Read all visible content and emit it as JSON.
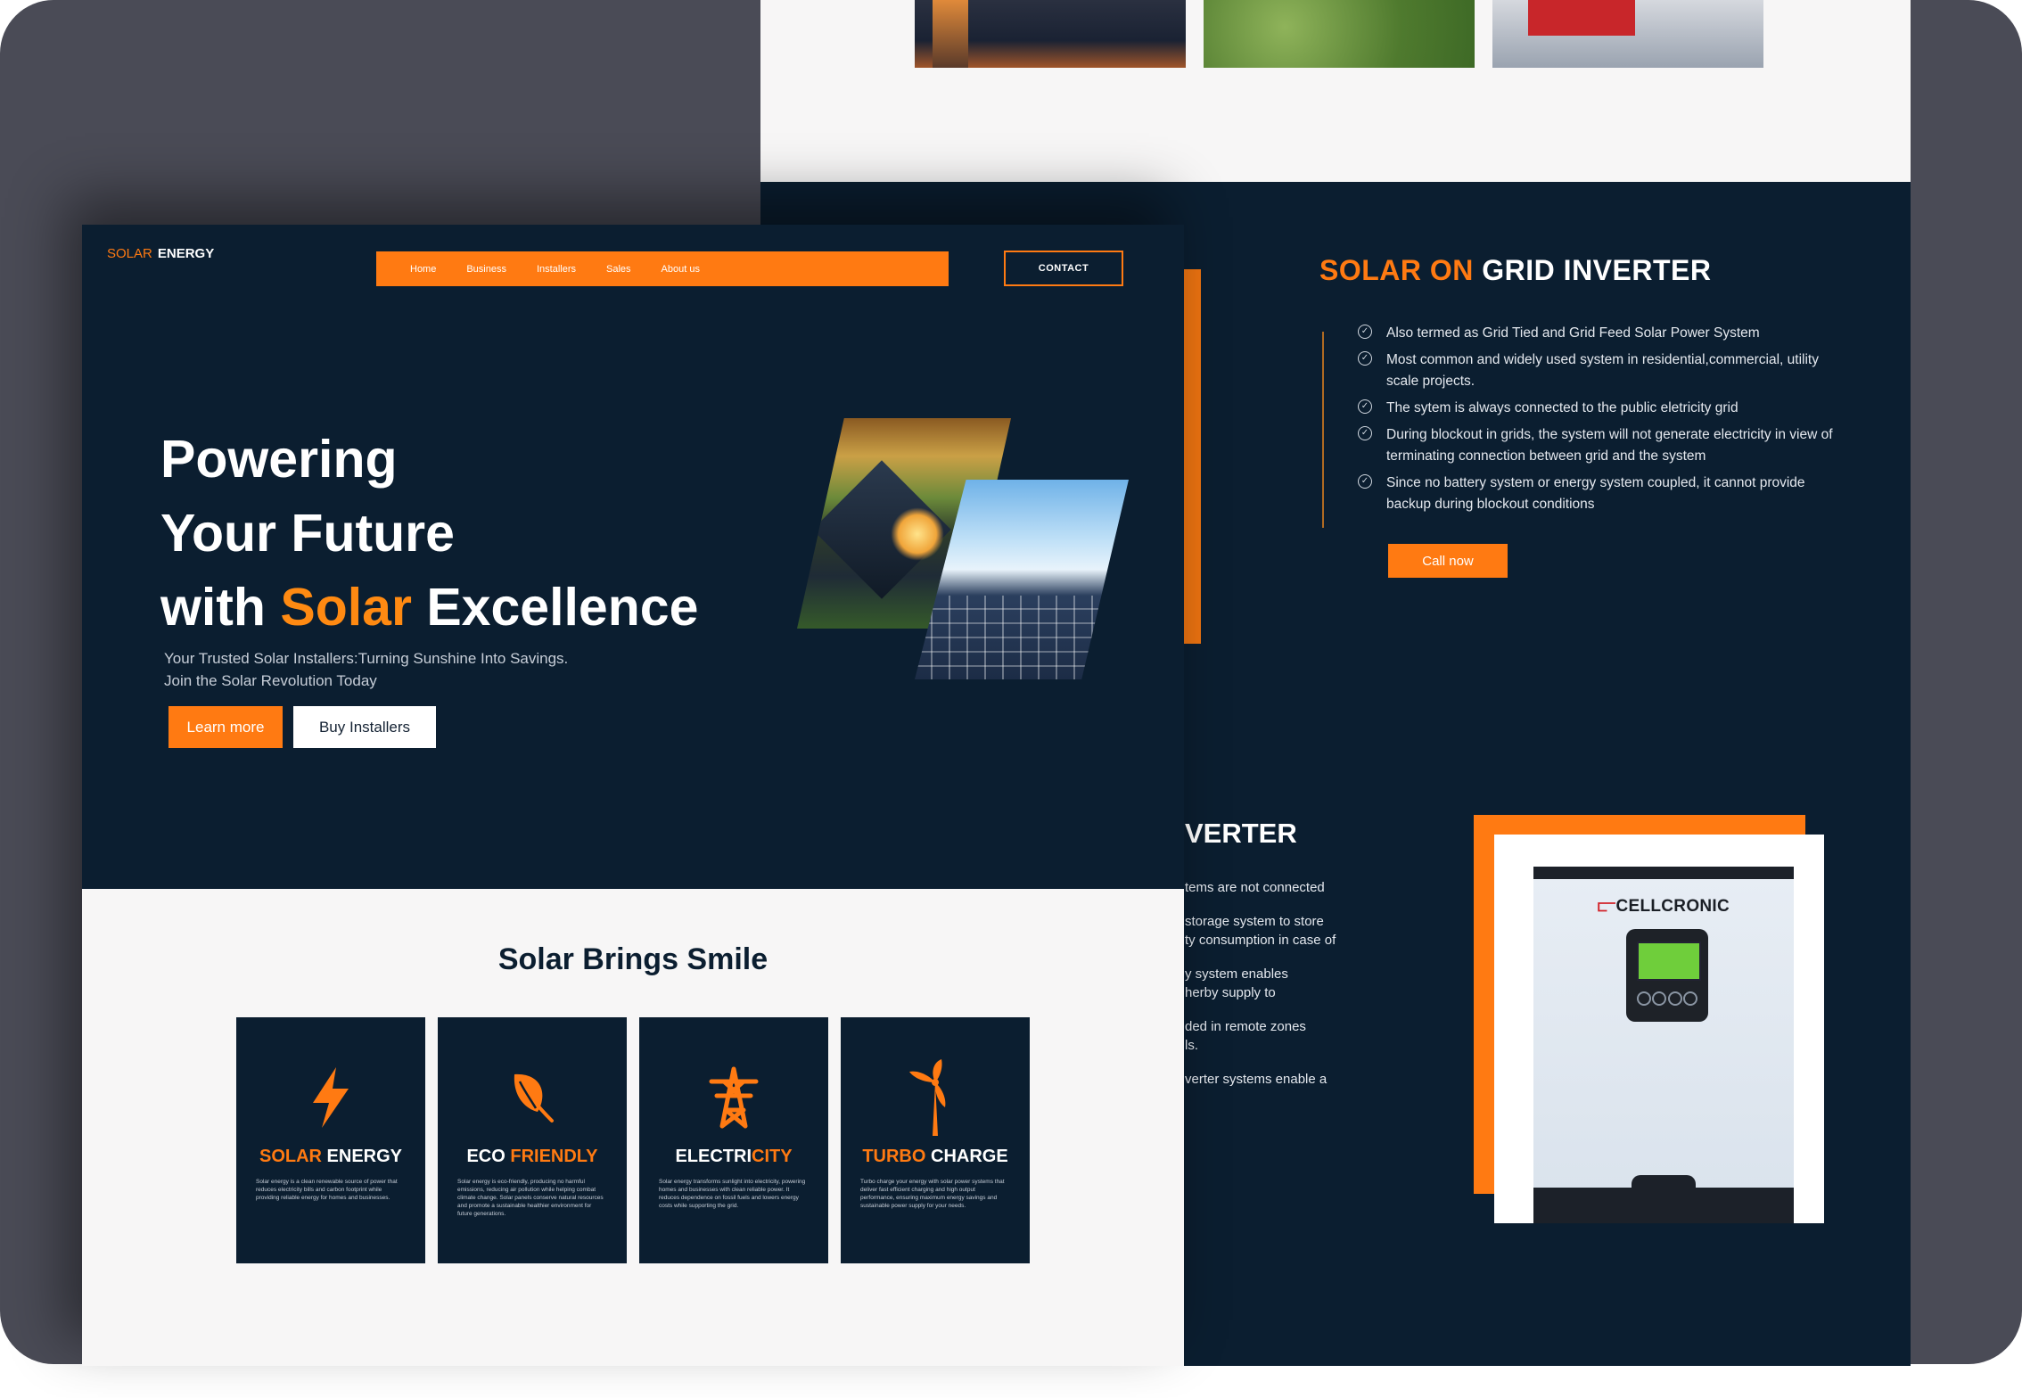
{
  "hero": {
    "logo": {
      "part1": "SOLAR",
      "part2": "ENERGY"
    },
    "nav": [
      "Home",
      "Business",
      "Installers",
      "Sales",
      "About us"
    ],
    "contact_label": "CONTACT",
    "title_line1": "Powering",
    "title_line2": "Your Future",
    "title_line3_pre": "with ",
    "title_line3_accent": "Solar",
    "title_line3_post": " Excellence",
    "subtitle_line1": "Your Trusted Solar Installers:Turning Sunshine Into Savings.",
    "subtitle_line2": "Join the Solar Revolution Today",
    "learn_more": "Learn more",
    "buy_installers": "Buy Installers"
  },
  "smile": {
    "title": "Solar Brings Smile",
    "cards": [
      {
        "title_accent": "SOLAR",
        "title_rest": " ENERGY",
        "icon": "lightning-icon",
        "text": "Solar energy is a clean renewable source of power that reduces electricity bills and carbon footprint while providing reliable energy for homes and businesses."
      },
      {
        "title_accent": "",
        "title_pre": "ECO ",
        "title_accent2": "FRIENDLY",
        "icon": "leaf-icon",
        "text": "Solar energy is eco-friendly, producing no harmful emissions, reducing air pollution while helping combat climate change. Solar panels conserve natural resources and promote a sustainable healthier environment for future generations."
      },
      {
        "title_pre": "ELECTRI",
        "title_accent2": "CITY",
        "icon": "power-tower-icon",
        "text": "Solar energy transforms sunlight into electricity, powering homes and businesses with clean reliable power. It reduces dependence on fossil fuels and lowers energy costs while supporting the grid."
      },
      {
        "title_accent": "TURBO",
        "title_rest": " CHARGE",
        "icon": "wind-turbine-icon",
        "text": "Turbo charge your energy with solar power systems that deliver fast efficient charging and high output performance, ensuring maximum energy savings and sustainable power supply for your needs."
      }
    ]
  },
  "grid_inverter": {
    "title_accent": "SOLAR ON",
    "title_rest": " GRID INVERTER",
    "bullets": [
      "Also termed as Grid Tied and Grid Feed Solar Power System",
      "Most common and widely used system in residential,commercial, utility scale projects.",
      "The sytem is always connected to the public eletricity grid",
      "During blockout in grids, the system will not generate electricity in view of terminating connection between grid and the system",
      "Since no battery system or energy system coupled, it cannot provide backup during blockout conditions"
    ],
    "call_now": "Call now"
  },
  "off_grid": {
    "title_partial": "VERTER",
    "lines": [
      "tems are not connected",
      "",
      "storage system to store",
      "ty consumption in case of",
      "",
      "y system enables",
      "herby supply to",
      "",
      "ded in remote zones",
      "ls.",
      "",
      "verter systems enable a"
    ],
    "inverter_brand": "CELLCRONIC"
  },
  "colors": {
    "accent": "#ff7a12",
    "navy": "#0b1e30"
  }
}
